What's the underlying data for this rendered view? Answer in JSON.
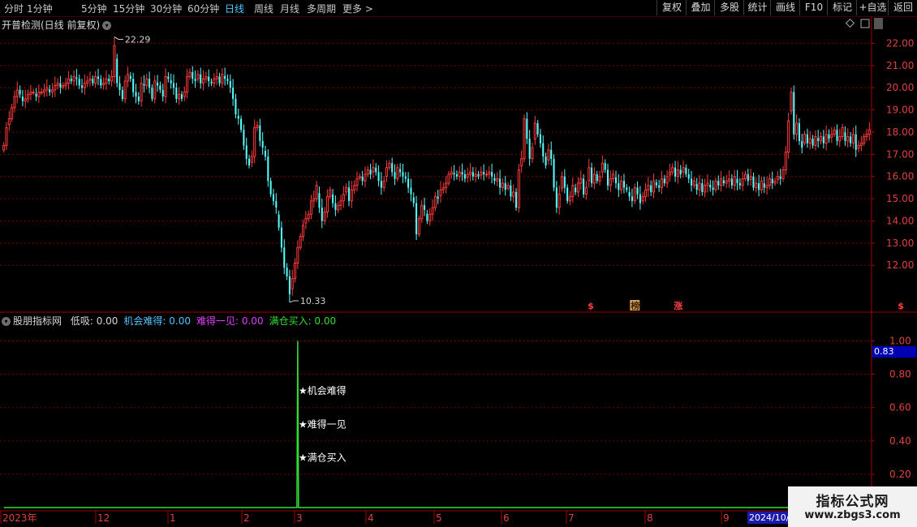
{
  "toolbar": {
    "periods": [
      "分时",
      "1分钟",
      "5分钟",
      "15分钟",
      "30分钟",
      "60分钟",
      "日线",
      "周线",
      "月线",
      "多周期",
      "更多 >"
    ],
    "active_period": "日线",
    "right_buttons": [
      "复权",
      "叠加",
      "多股",
      "统计",
      "画线",
      "F10",
      "标记",
      "+自选",
      "返回"
    ]
  },
  "main_panel": {
    "title": "开普检测(日线 前复权)",
    "high_label": "22.29",
    "low_label": "10.33",
    "event_markers": [
      "$",
      "榜",
      "涨",
      "$"
    ],
    "y_axis_ticks": [
      "22.00",
      "21.00",
      "20.00",
      "19.00",
      "18.00",
      "17.00",
      "16.00",
      "15.00",
      "14.00",
      "13.00",
      "12.00"
    ]
  },
  "indicator_panel": {
    "name": "股朋指标网",
    "values": [
      {
        "label": "低吸:",
        "value": "0.00",
        "color": "#d8d8d8"
      },
      {
        "label": "机会难得:",
        "value": "0.00",
        "color": "#4fc3ff"
      },
      {
        "label": "难得一见:",
        "value": "0.00",
        "color": "#e040fb"
      },
      {
        "label": "满仓买入:",
        "value": "0.00",
        "color": "#33dd33"
      }
    ],
    "annotations": [
      "★机会难得",
      "★难得一见",
      "★满仓买入"
    ],
    "y_axis_ticks": [
      "1.00",
      "0.80",
      "0.60",
      "0.40",
      "0.20"
    ],
    "current_value": "0.83"
  },
  "x_axis": {
    "labels": [
      "2023年",
      "12",
      "1",
      "2",
      "3",
      "4",
      "5",
      "6",
      "7",
      "8",
      "9"
    ],
    "cursor_date": "2024/10/"
  },
  "watermark": {
    "line1": "指标公式网",
    "line2": "www.zbgs3.com"
  },
  "colors": {
    "up": "#ff3b3b",
    "down": "#54ffff",
    "grid": "#7a0000",
    "axis": "#a00000",
    "signal": "#33dd33"
  },
  "chart_data": [
    {
      "type": "candlestick",
      "title": "开普检测(日线 前复权)",
      "ylim": [
        10,
        22.6
      ],
      "annotations": [
        {
          "label": "22.29",
          "x_index": 41
        },
        {
          "label": "10.33",
          "x_index": 106
        }
      ],
      "closes": [
        17.4,
        18.2,
        18.6,
        19.1,
        19.6,
        19.9,
        19.7,
        19.4,
        19.5,
        19.7,
        19.8,
        19.8,
        19.6,
        19.8,
        19.8,
        19.9,
        20,
        19.8,
        19.9,
        20.1,
        20.2,
        20,
        20.1,
        20.2,
        20.4,
        20.3,
        20.5,
        20.4,
        20.1,
        20,
        20.2,
        20.3,
        20.4,
        20.2,
        20.5,
        20.4,
        20.1,
        20.2,
        20.4,
        20.3,
        20.5,
        21.9,
        20.2,
        19.9,
        19.5,
        20.3,
        20.6,
        20.4,
        19.8,
        19.6,
        19.4,
        20.2,
        20.1,
        20.4,
        20,
        19.5,
        20.3,
        20.1,
        19.9,
        19.6,
        20.5,
        20.4,
        20.2,
        20,
        19.5,
        19.7,
        19.5,
        19.8,
        20.5,
        20.7,
        20.4,
        20.3,
        20.6,
        20.2,
        20.4,
        20.5,
        20.3,
        20.2,
        20.4,
        20.5,
        20.2,
        20.6,
        20.4,
        20.3,
        20,
        19.5,
        18.8,
        18.6,
        18.1,
        17.4,
        16.8,
        16.5,
        16.9,
        18.2,
        18.3,
        17.6,
        17.3,
        16.9,
        15.8,
        15.2,
        14.9,
        14.6,
        13.7,
        12.8,
        11.9,
        11.5,
        10.7,
        11.4,
        12.1,
        12.8,
        13.3,
        13.8,
        14.1,
        14.3,
        14.9,
        15,
        15.6,
        14.6,
        14,
        14.4,
        15.1,
        15.4,
        14.8,
        14.5,
        14.7,
        14.9,
        15.2,
        15.5,
        14.9,
        15.4,
        15.6,
        15.9,
        16,
        15.8,
        16.1,
        16.3,
        16.1,
        16.4,
        16.2,
        15.8,
        15.5,
        15.8,
        16.4,
        16.6,
        16.2,
        15.9,
        16.4,
        16.2,
        16,
        15.9,
        15.5,
        15.2,
        14.8,
        13.4,
        14.1,
        14.7,
        14.5,
        14,
        14.3,
        14.6,
        15.1,
        15,
        15.4,
        15.5,
        15.7,
        16.1,
        16.2,
        16.1,
        16,
        16.2,
        16.1,
        15.9,
        16.1,
        16.2,
        16,
        16.1,
        16,
        16.2,
        16.1,
        16.1,
        16.2,
        16,
        15.8,
        15.9,
        15.5,
        15.7,
        15.4,
        15.6,
        15.1,
        15.3,
        14.6,
        16.3,
        16.8,
        18.6,
        17.7,
        16.8,
        17.3,
        18.4,
        17.9,
        17.5,
        16.9,
        16.5,
        17.2,
        16.8,
        15.5,
        14.6,
        15.2,
        16,
        15.5,
        14.9,
        15.1,
        15.6,
        15.3,
        15.7,
        15.9,
        15.2,
        15.5,
        16.4,
        15.7,
        16.1,
        15.8,
        16,
        16.6,
        16.3,
        15.6,
        15.9,
        16.1,
        15.7,
        15.4,
        15.8,
        15.5,
        15.4,
        15.1,
        14.9,
        15.5,
        15.2,
        14.8,
        15.1,
        15.4,
        15.6,
        15.3,
        15.8,
        15.6,
        15.5,
        15.9,
        15.7,
        16,
        16.2,
        16.4,
        16,
        16.3,
        16.1,
        16.4,
        16.1,
        15.9,
        15.6,
        15.8,
        15.4,
        15.7,
        15.3,
        15.6,
        15.7,
        15.5,
        15.4,
        15.8,
        15.6,
        15.9,
        15.7,
        15.8,
        15.9,
        15.6,
        16,
        15.7,
        15.6,
        15.9,
        16.1,
        15.8,
        16,
        15.5,
        15.7,
        15.4,
        15.8,
        15.5,
        15.6,
        15.9,
        15.7,
        15.8,
        16,
        15.9,
        16.3,
        17.1,
        18.5,
        19.8,
        17.9,
        18.4,
        17.6,
        17.3,
        17.9,
        17.5,
        17.7,
        17.4,
        17.8,
        17.6,
        17.8,
        17.5,
        17.9,
        17.7,
        17.9,
        18.1,
        17.6,
        17.8,
        18.2,
        17.6,
        17.8,
        17.5,
        17.9,
        17.2,
        17.4,
        17.5,
        17.8,
        17.9,
        18.1
      ]
    },
    {
      "type": "line",
      "series": [
        {
          "name": "满仓买入",
          "color": "#33dd33"
        }
      ],
      "ylim": [
        0,
        1.1
      ],
      "spike_index": 109,
      "spike_value": 1.0
    }
  ]
}
